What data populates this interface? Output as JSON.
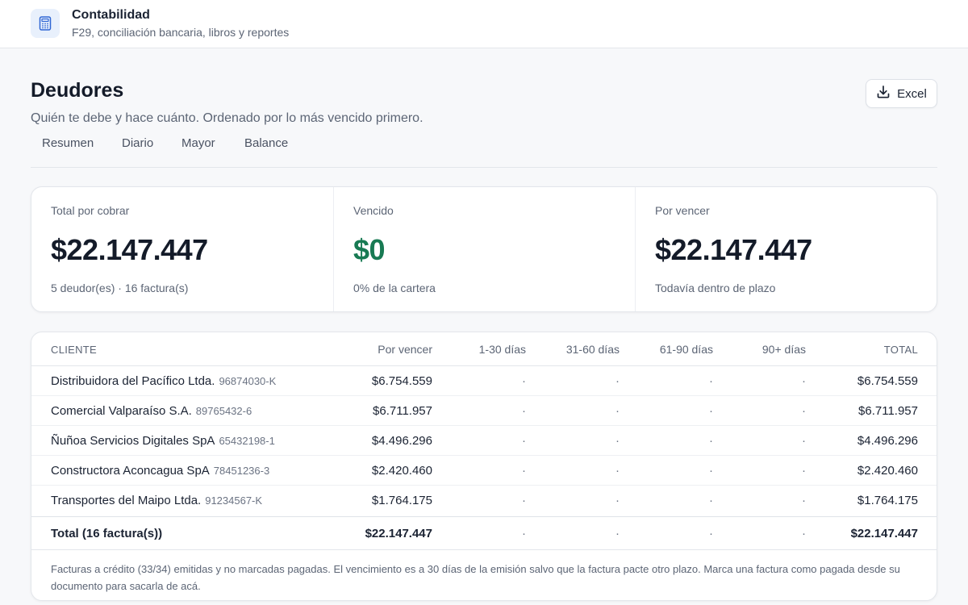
{
  "app": {
    "title": "Contabilidad",
    "subtitle": "F29, conciliación bancaria, libros y reportes",
    "icon": "calculator-icon",
    "accent": "#2f66d4"
  },
  "page": {
    "title": "Deudores",
    "description": "Quién te debe y hace cuánto. Ordenado por lo más vencido primero.",
    "excel_label": "Excel"
  },
  "tabs": [
    {
      "label": "Resumen"
    },
    {
      "label": "Diario"
    },
    {
      "label": "Mayor"
    },
    {
      "label": "Balance"
    }
  ],
  "summary": {
    "total": {
      "label": "Total por cobrar",
      "value": "$22.147.447",
      "note": "5 deudor(es) · 16 factura(s)"
    },
    "vencido": {
      "label": "Vencido",
      "value": "$0",
      "note": "0% de la cartera",
      "color": "#187a53"
    },
    "por_vencer": {
      "label": "Por vencer",
      "value": "$22.147.447",
      "note": "Todavía dentro de plazo"
    }
  },
  "table": {
    "headers": {
      "cliente": "Cliente",
      "por_vencer": "Por vencer",
      "d1_30": "1-30 días",
      "d31_60": "31-60 días",
      "d61_90": "61-90 días",
      "d90": "90+ días",
      "total": "Total"
    },
    "rows": [
      {
        "name": "Distribuidora del Pacífico Ltda.",
        "rut": "96874030-K",
        "por_vencer": "$6.754.559",
        "d1_30": "·",
        "d31_60": "·",
        "d61_90": "·",
        "d90": "·",
        "total": "$6.754.559"
      },
      {
        "name": "Comercial Valparaíso S.A.",
        "rut": "89765432-6",
        "por_vencer": "$6.711.957",
        "d1_30": "·",
        "d31_60": "·",
        "d61_90": "·",
        "d90": "·",
        "total": "$6.711.957"
      },
      {
        "name": "Ñuñoa Servicios Digitales SpA",
        "rut": "65432198-1",
        "por_vencer": "$4.496.296",
        "d1_30": "·",
        "d31_60": "·",
        "d61_90": "·",
        "d90": "·",
        "total": "$4.496.296"
      },
      {
        "name": "Constructora Aconcagua SpA",
        "rut": "78451236-3",
        "por_vencer": "$2.420.460",
        "d1_30": "·",
        "d31_60": "·",
        "d61_90": "·",
        "d90": "·",
        "total": "$2.420.460"
      },
      {
        "name": "Transportes del Maipo Ltda.",
        "rut": "91234567-K",
        "por_vencer": "$1.764.175",
        "d1_30": "·",
        "d31_60": "·",
        "d61_90": "·",
        "d90": "·",
        "total": "$1.764.175"
      }
    ],
    "total_row": {
      "label": "Total (16 factura(s))",
      "por_vencer": "$22.147.447",
      "d1_30": "·",
      "d31_60": "·",
      "d61_90": "·",
      "d90": "·",
      "total": "$22.147.447"
    },
    "footnote": "Facturas a crédito (33/34) emitidas y no marcadas pagadas. El vencimiento es a 30 días de la emisión salvo que la factura pacte otro plazo. Marca una factura como pagada desde su documento para sacarla de acá."
  }
}
